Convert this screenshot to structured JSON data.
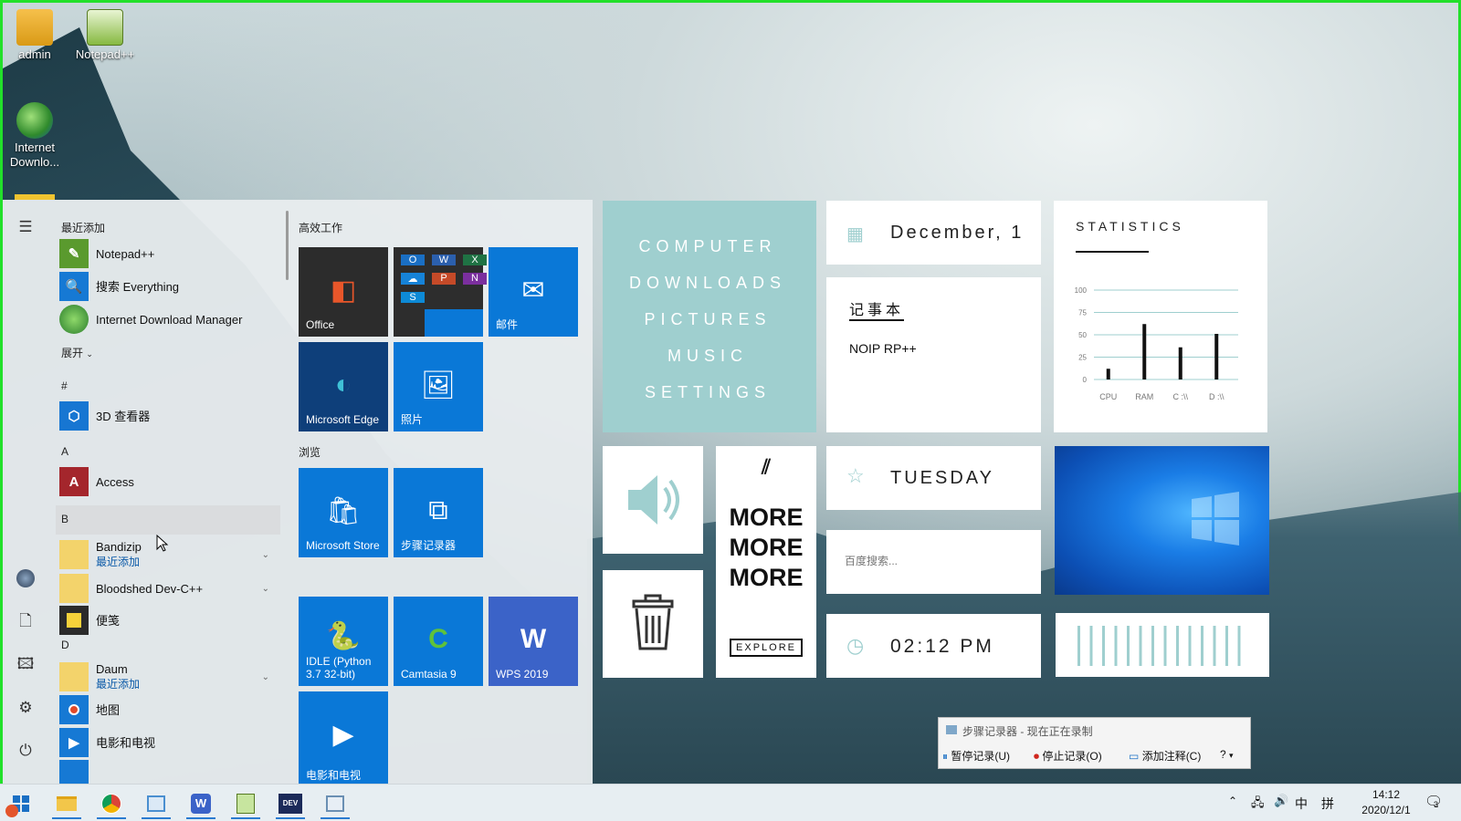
{
  "desktop": {
    "icons": [
      {
        "label": "admin"
      },
      {
        "label": "Notepad++"
      },
      {
        "label": "Internet\nDownlo..."
      }
    ]
  },
  "start": {
    "recent_header": "最近添加",
    "recent": [
      "Notepad++",
      "搜索 Everything",
      "Internet Download Manager"
    ],
    "expand": "展开",
    "sections": {
      "hash": "#",
      "a": "A",
      "b": "B",
      "d": "D"
    },
    "apps": {
      "viewer3d": "3D 查看器",
      "access": "Access",
      "bandizip": "Bandizip",
      "bandizip_sub": "最近添加",
      "devcpp": "Bloodshed Dev-C++",
      "sticky": "便笺",
      "daum": "Daum",
      "daum_sub": "最近添加",
      "maps": "地图",
      "movies": "电影和电视"
    },
    "tile_groups": {
      "work": "高效工作",
      "browse": "浏览"
    },
    "tiles": {
      "office": "Office",
      "mail": "邮件",
      "edge": "Microsoft Edge",
      "photos": "照片",
      "store": "Microsoft Store",
      "psr": "步骤记录器",
      "idle": "IDLE (Python 3.7 32-bit)",
      "camtasia": "Camtasia 9",
      "wps": "WPS 2019",
      "movies": "电影和电视"
    }
  },
  "widgets": {
    "nav": [
      "COMPUTER",
      "DOWNLOADS",
      "PICTURES",
      "MUSIC",
      "SETTINGS"
    ],
    "date": "December, 1",
    "notes_title": "记事本",
    "notes_body": "NOIP RP++",
    "day": "TUESDAY",
    "search_placeholder": "百度搜索...",
    "time": "02:12 PM",
    "more": [
      "MORE",
      "MORE",
      "MORE"
    ],
    "explore": "EXPLORE",
    "stats_title": "STATISTICS"
  },
  "chart_data": {
    "type": "bar",
    "title": "STATISTICS",
    "categories": [
      "CPU",
      "RAM",
      "C :\\\\",
      "D :\\\\"
    ],
    "values": [
      12,
      62,
      36,
      51
    ],
    "ylim": [
      0,
      100
    ],
    "yticks": [
      0,
      25,
      50,
      75,
      100
    ],
    "grid": true
  },
  "psr": {
    "title": "步骤记录器 - 现在正在录制",
    "pause": "暂停记录(U)",
    "stop": "停止记录(O)",
    "comment": "添加注释(C)"
  },
  "taskbar": {
    "time": "14:12",
    "date": "2020/12/1",
    "ime": "中",
    "ime2": "拼",
    "notif_count": "3"
  }
}
